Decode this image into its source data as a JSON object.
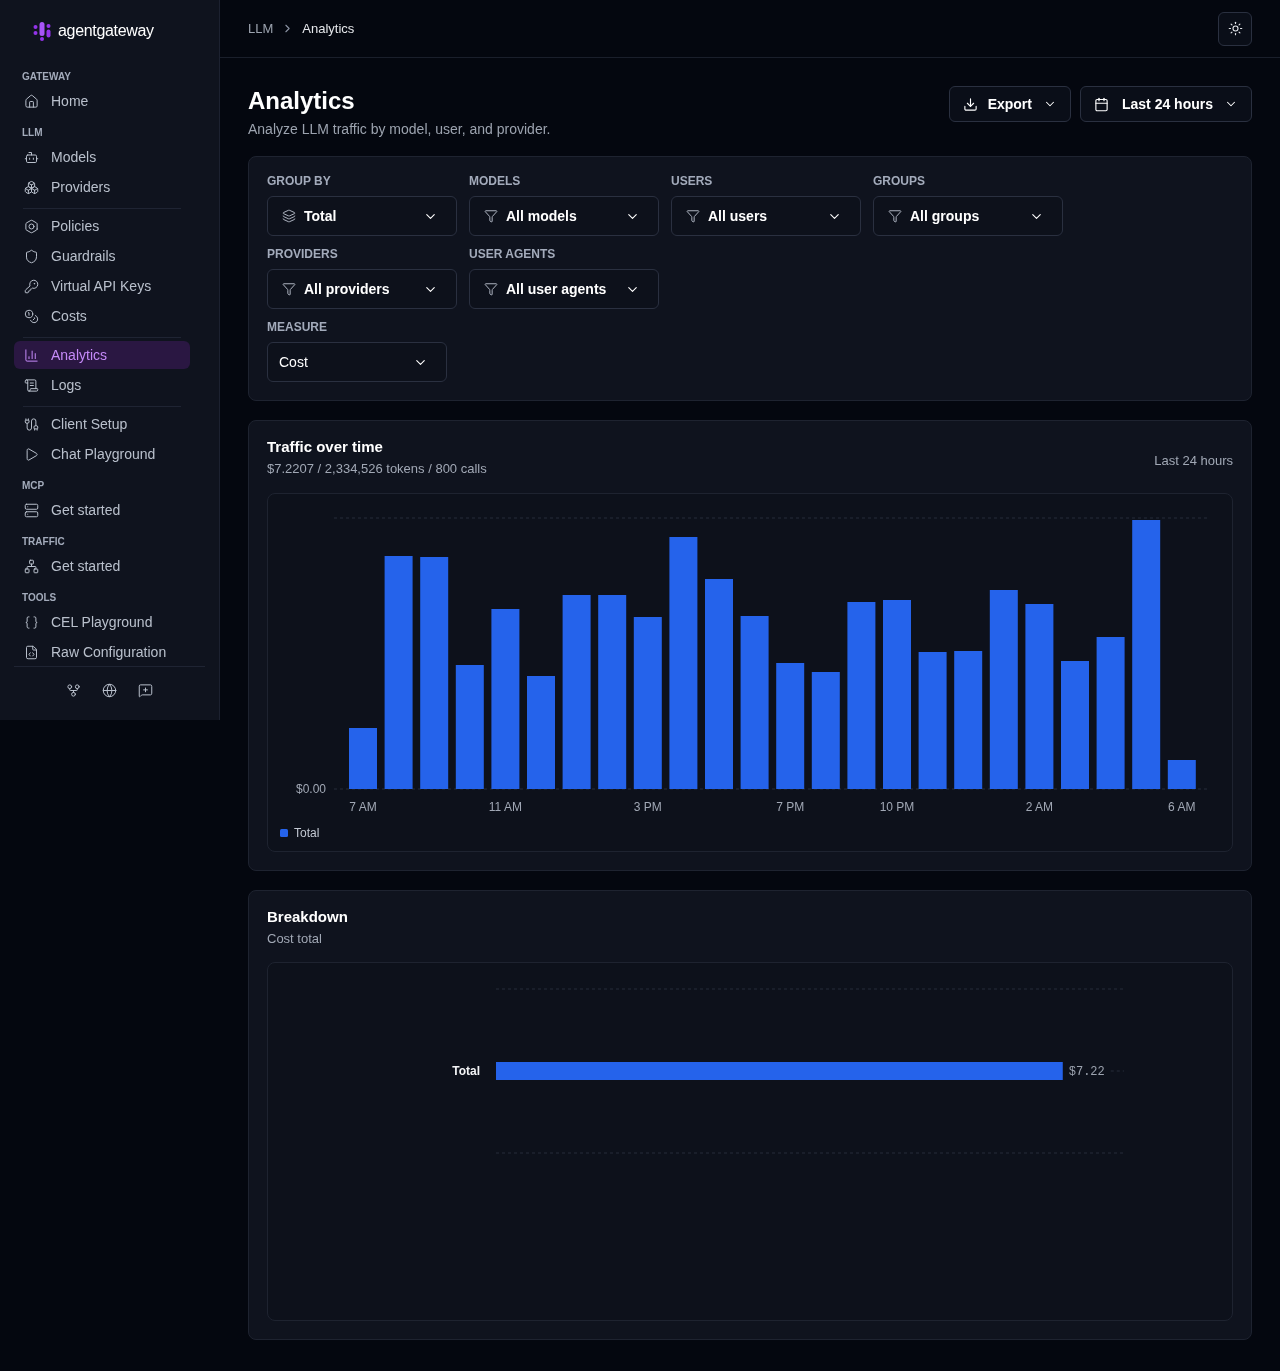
{
  "sidebar": {
    "logo": "agentgateway",
    "sections": [
      {
        "title": "GATEWAY",
        "groups": [
          {
            "items": [
              {
                "label": "Home",
                "selected": false
              }
            ]
          }
        ]
      },
      {
        "title": "LLM",
        "groups": [
          {
            "items": [
              {
                "label": "Models",
                "selected": false
              },
              {
                "label": "Providers",
                "selected": false
              }
            ]
          },
          {
            "items": [
              {
                "label": "Policies",
                "selected": false
              },
              {
                "label": "Guardrails",
                "selected": false
              },
              {
                "label": "Virtual API Keys",
                "selected": false
              },
              {
                "label": "Costs",
                "selected": false
              }
            ]
          },
          {
            "items": [
              {
                "label": "Analytics",
                "selected": true
              },
              {
                "label": "Logs",
                "selected": false
              }
            ]
          },
          {
            "items": [
              {
                "label": "Client Setup",
                "selected": false
              },
              {
                "label": "Chat Playground",
                "selected": false
              }
            ]
          }
        ]
      },
      {
        "title": "MCP",
        "groups": [
          {
            "items": [
              {
                "label": "Get started",
                "selected": false
              }
            ]
          }
        ]
      },
      {
        "title": "TRAFFIC",
        "groups": [
          {
            "items": [
              {
                "label": "Get started",
                "selected": false
              }
            ]
          }
        ]
      },
      {
        "title": "TOOLS",
        "groups": [
          {
            "items": [
              {
                "label": "CEL Playground",
                "selected": false
              },
              {
                "label": "Raw Configuration",
                "selected": false
              }
            ]
          }
        ]
      }
    ]
  },
  "breadcrumb": [
    {
      "label": "LLM"
    },
    {
      "label": "Analytics"
    }
  ],
  "page": {
    "title": "Analytics",
    "subtitle": "Analyze LLM traffic by model, user, and provider.",
    "actions": [
      {
        "kind": "export",
        "label": "Export"
      },
      {
        "kind": "date_range",
        "label": "Last 24 hours"
      }
    ]
  },
  "filters": {
    "rows": [
      {
        "fields": [
          {
            "kind": "group",
            "label": "GROUP BY",
            "value": "Total"
          },
          {
            "kind": "filter",
            "label": "MODELS",
            "value": "All models"
          },
          {
            "kind": "filter",
            "label": "USERS",
            "value": "All users"
          },
          {
            "kind": "filter",
            "label": "GROUPS",
            "value": "All groups"
          }
        ]
      },
      {
        "fields": [
          {
            "kind": "filter",
            "label": "PROVIDERS",
            "value": "All providers"
          },
          {
            "kind": "filter",
            "label": "USER AGENTS",
            "value": "All user agents"
          }
        ]
      },
      {
        "fields": [
          {
            "kind": "measure",
            "label": "MEASURE",
            "value": "Cost"
          }
        ]
      }
    ]
  },
  "traffic": {
    "title": "Traffic over time",
    "summary": "$7.2207 / 2,334,526 tokens / 800 calls",
    "range": "Last 24 hours",
    "y_tick": "$0.00",
    "x_ticks": [
      "7 AM",
      "11 AM",
      "3 PM",
      "7 PM",
      "10 PM",
      "2 AM",
      "6 AM"
    ],
    "legend": [
      {
        "label": "Total"
      }
    ]
  },
  "breakdown": {
    "title": "Breakdown",
    "subtitle": "Cost total",
    "chart_data": {
      "type": "bar",
      "orientation": "horizontal",
      "categories": [
        "Total"
      ],
      "values": [
        7.22
      ],
      "value_labels": [
        "$7.22"
      ]
    }
  }
}
